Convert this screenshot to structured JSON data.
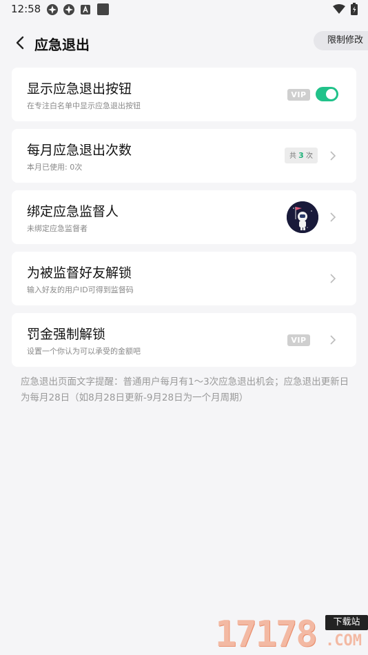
{
  "status_bar": {
    "time": "12:58",
    "icons": [
      "app-icon",
      "app-icon",
      "a-icon",
      "square-icon",
      "wifi-icon",
      "battery-icon"
    ]
  },
  "header": {
    "title": "应急退出",
    "restrict_button": "限制修改"
  },
  "items": [
    {
      "title": "显示应急退出按钮",
      "subtitle": "在专注白名单中显示应急退出按钮",
      "vip": "VIP",
      "toggle_on": true
    },
    {
      "title": "每月应急退出次数",
      "subtitle": "本月已使用: 0次",
      "count_prefix": "共",
      "count_value": "3",
      "count_suffix": "次"
    },
    {
      "title": "绑定应急监督人",
      "subtitle": "未绑定应急监督者"
    },
    {
      "title": "为被监督好友解锁",
      "subtitle": "输入好友的用户ID可得到监督码"
    },
    {
      "title": "罚金强制解锁",
      "subtitle": "设置一个你认为可以承受的金额吧",
      "vip": "VIP"
    }
  ],
  "footnote": "应急退出页面文字提醒：普通用户每月有1～3次应急退出机会；应急退出更新日为每月28日（如8月28日更新-9月28日为一个月周期）",
  "watermark": {
    "digits": "17178",
    "tag": "下载站",
    "suffix": ".COM"
  },
  "colors": {
    "accent_green": "#21c28a",
    "vip_gray": "#cfcfcf",
    "background": "#f5f5f7"
  }
}
